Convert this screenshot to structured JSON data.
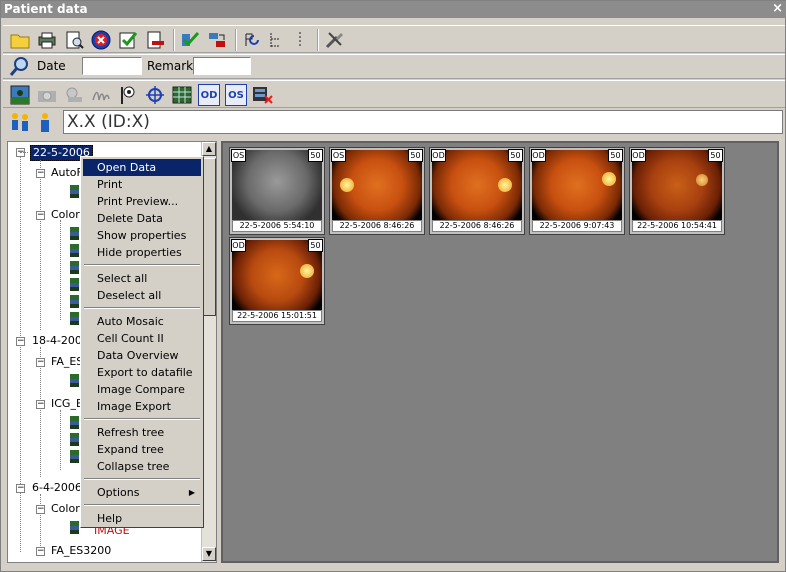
{
  "window": {
    "title": "Patient data",
    "close": "×"
  },
  "search": {
    "date_label": "Date",
    "remark_label": "Remark",
    "date_value": "",
    "remark_value": ""
  },
  "patient": {
    "name": "X.X (ID:X)"
  },
  "toolbar3": {
    "od": "OD",
    "os": "OS"
  },
  "tree": {
    "items": [
      {
        "label": "22-5-2006",
        "level": 0,
        "selected": true
      },
      {
        "label": "AutoF",
        "level": 1
      },
      {
        "label": "ColorI",
        "level": 1
      },
      {
        "label": "18-4-2006",
        "level": 0
      },
      {
        "label": "FA_ES",
        "level": 1
      },
      {
        "label": "ICG_E",
        "level": 1
      },
      {
        "label": "6-4-2006",
        "level": 0
      },
      {
        "label": "ColorI",
        "level": 1
      },
      {
        "label": "IMAGE",
        "level": 2
      },
      {
        "label": "FA_ES3200",
        "level": 1
      }
    ]
  },
  "context_menu": {
    "items": [
      "Open Data",
      "Print",
      "Print Preview...",
      "Delete Data",
      "Show properties",
      "Hide properties",
      "Select all",
      "Deselect all",
      "Auto Mosaic",
      "Cell Count II",
      "Data Overview",
      "Export to datafile",
      "Image Compare",
      "Image Export",
      "Refresh tree",
      "Expand tree",
      "Collapse tree",
      "Options",
      "Help"
    ]
  },
  "thumbnails": [
    {
      "eye": "OS",
      "zoom": "50",
      "timestamp": "22-5-2006 5:54:10",
      "type": "autofluorescence"
    },
    {
      "eye": "OS",
      "zoom": "50",
      "timestamp": "22-5-2006 8:46:26",
      "type": "color"
    },
    {
      "eye": "OD",
      "zoom": "50",
      "timestamp": "22-5-2006 8:46:26",
      "type": "color"
    },
    {
      "eye": "OD",
      "zoom": "50",
      "timestamp": "22-5-2006 9:07:43",
      "type": "color"
    },
    {
      "eye": "OD",
      "zoom": "50",
      "timestamp": "22-5-2006 10:54:41",
      "type": "color"
    },
    {
      "eye": "OD",
      "zoom": "50",
      "timestamp": "22-5-2006 15:01:51",
      "type": "color"
    }
  ],
  "colors": {
    "selection": "#0a246a",
    "gallery_bg": "#808080",
    "fundus": "#c8561a",
    "titlebar": "#8c8c8c"
  }
}
